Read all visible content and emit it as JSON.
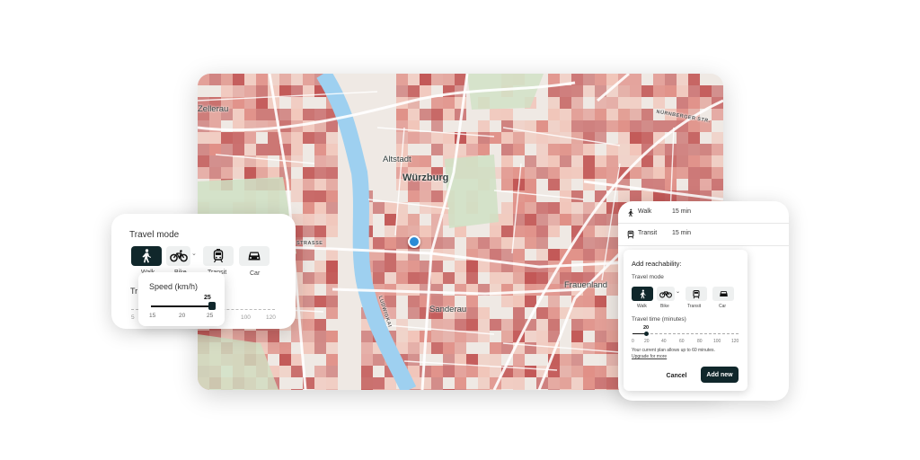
{
  "map": {
    "labels": {
      "altstadt": "Altstadt",
      "wuerzburg": "Würzburg",
      "frauenland": "Frauenland",
      "sanderau": "Sanderau",
      "zellerau": "Zellerau",
      "nuernberger": "NÜRNBERGER STR.",
      "strasse": "STRASSE",
      "ludwigkai": "LUDWIGKAI"
    },
    "colors": {
      "heat_dark": "#c0504f",
      "heat_mid": "#df8b82",
      "heat_light": "#f1c3b7",
      "river": "#9ed0f0",
      "park": "#cfe1c4",
      "pin": "#2a8bd6"
    }
  },
  "travel_panel": {
    "title": "Travel mode",
    "modes": [
      {
        "icon": "walk-icon",
        "label": "Walk",
        "active": true
      },
      {
        "icon": "bike-icon",
        "label": "Bike",
        "active": false
      },
      {
        "icon": "transit-icon",
        "label": "Transit",
        "active": false
      },
      {
        "icon": "car-icon",
        "label": "Car",
        "active": false
      }
    ],
    "bike_chevron": "⌄",
    "hidden_label": "Tr",
    "time_ticks": [
      "5",
      "100",
      "120"
    ]
  },
  "speed_popup": {
    "title": "Speed (km/h)",
    "value": "25",
    "ticks": [
      "15",
      "20",
      "25"
    ]
  },
  "reachability_list": [
    {
      "icon": "walk-icon",
      "mode": "Walk",
      "time": "15 min"
    },
    {
      "icon": "transit-icon",
      "mode": "Transit",
      "time": "15 min"
    }
  ],
  "add_card": {
    "title": "Add reachability:",
    "travel_mode_label": "Travel mode",
    "modes": [
      {
        "icon": "walk-icon",
        "label": "Walk",
        "active": true
      },
      {
        "icon": "bike-icon",
        "label": "Bike",
        "active": false
      },
      {
        "icon": "transit-icon",
        "label": "Transit",
        "active": false
      },
      {
        "icon": "car-icon",
        "label": "Car",
        "active": false
      }
    ],
    "bike_chevron": "⌄",
    "travel_time_label": "Travel time (minutes)",
    "travel_time_value": "20",
    "ticks": [
      "0",
      "20",
      "40",
      "60",
      "80",
      "100",
      "120"
    ],
    "plan_note": "Your current plan allows up to 60 minutes.",
    "upgrade_link": "Upgrade for more",
    "cancel_label": "Cancel",
    "add_label": "Add new"
  }
}
